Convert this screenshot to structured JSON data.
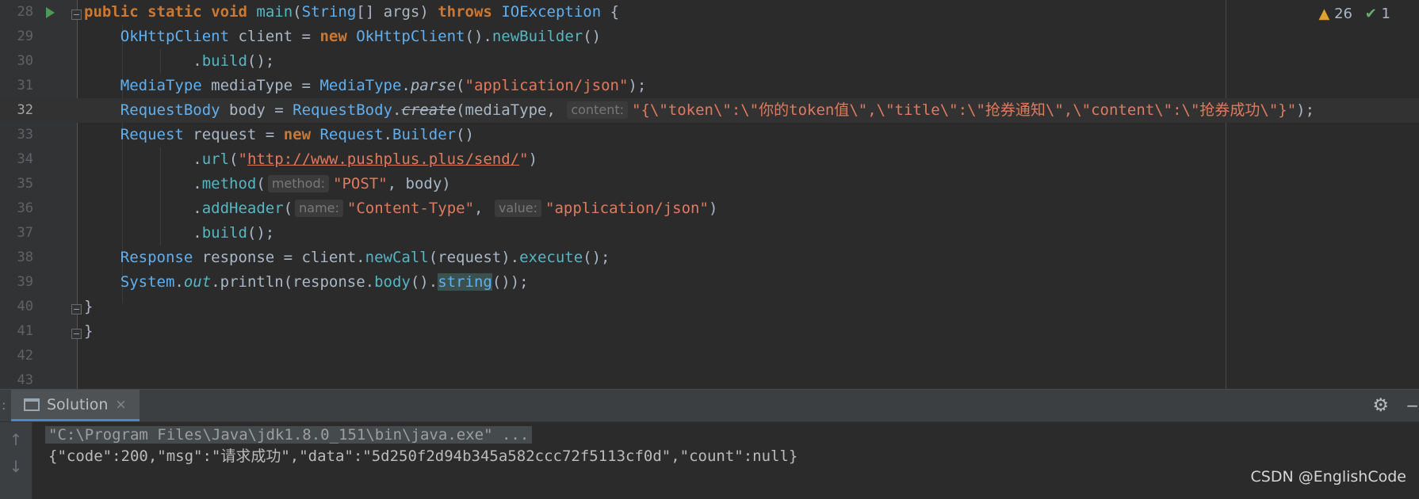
{
  "editor": {
    "inspections": {
      "warnings": "26",
      "ok": "1"
    },
    "lines": [
      {
        "n": "28",
        "parts": [
          {
            "t": "public",
            "c": "kw"
          },
          {
            "t": " "
          },
          {
            "t": "static",
            "c": "kw"
          },
          {
            "t": " "
          },
          {
            "t": "void",
            "c": "kw"
          },
          {
            "t": " "
          },
          {
            "t": "main",
            "c": "fn"
          },
          {
            "t": "("
          },
          {
            "t": "String",
            "c": "cls"
          },
          {
            "t": "[] args) "
          },
          {
            "t": "throws",
            "c": "kw"
          },
          {
            "t": " "
          },
          {
            "t": "IOException",
            "c": "cls"
          },
          {
            "t": " {"
          }
        ]
      },
      {
        "n": "29",
        "parts": [
          {
            "t": "    "
          },
          {
            "t": "OkHttpClient",
            "c": "cls"
          },
          {
            "t": " client = "
          },
          {
            "t": "new",
            "c": "kw"
          },
          {
            "t": " "
          },
          {
            "t": "OkHttpClient",
            "c": "cls"
          },
          {
            "t": "()."
          },
          {
            "t": "newBuilder",
            "c": "fn"
          },
          {
            "t": "()"
          }
        ]
      },
      {
        "n": "30",
        "parts": [
          {
            "t": "            ."
          },
          {
            "t": "build",
            "c": "fn"
          },
          {
            "t": "();"
          }
        ]
      },
      {
        "n": "31",
        "parts": [
          {
            "t": "    "
          },
          {
            "t": "MediaType",
            "c": "cls"
          },
          {
            "t": " mediaType = "
          },
          {
            "t": "MediaType",
            "c": "cls"
          },
          {
            "t": "."
          },
          {
            "t": "parse",
            "c": "it"
          },
          {
            "t": "("
          },
          {
            "t": "\"application/json\"",
            "c": "str"
          },
          {
            "t": ");"
          }
        ]
      },
      {
        "n": "32",
        "current": true,
        "parts": [
          {
            "t": "    "
          },
          {
            "t": "RequestBody",
            "c": "cls"
          },
          {
            "t": " body = "
          },
          {
            "t": "RequestBody",
            "c": "cls"
          },
          {
            "t": "."
          },
          {
            "t": "create",
            "c": "it del"
          },
          {
            "t": "(mediaType, "
          },
          {
            "t": "content:",
            "c": "hint"
          },
          {
            "t": "\"{\\\"token\\\":\\\"你的token值\\\",\\\"title\\\":\\\"抢券通知\\\",\\\"content\\\":\\\"抢券成功\\\"}\"",
            "c": "str"
          },
          {
            "t": ");"
          }
        ]
      },
      {
        "n": "33",
        "parts": [
          {
            "t": "    "
          },
          {
            "t": "Request",
            "c": "cls"
          },
          {
            "t": " request = "
          },
          {
            "t": "new",
            "c": "kw"
          },
          {
            "t": " "
          },
          {
            "t": "Request",
            "c": "cls"
          },
          {
            "t": "."
          },
          {
            "t": "Builder",
            "c": "cls"
          },
          {
            "t": "()"
          }
        ]
      },
      {
        "n": "34",
        "parts": [
          {
            "t": "            ."
          },
          {
            "t": "url",
            "c": "fn"
          },
          {
            "t": "("
          },
          {
            "t": "\"",
            "c": "str"
          },
          {
            "t": "http://www.pushplus.plus/send/",
            "c": "str url"
          },
          {
            "t": "\"",
            "c": "str"
          },
          {
            "t": ")"
          }
        ]
      },
      {
        "n": "35",
        "parts": [
          {
            "t": "            ."
          },
          {
            "t": "method",
            "c": "fn"
          },
          {
            "t": "("
          },
          {
            "t": "method:",
            "c": "hint"
          },
          {
            "t": "\"POST\"",
            "c": "str"
          },
          {
            "t": ", body)"
          }
        ]
      },
      {
        "n": "36",
        "parts": [
          {
            "t": "            ."
          },
          {
            "t": "addHeader",
            "c": "fn"
          },
          {
            "t": "("
          },
          {
            "t": "name:",
            "c": "hint"
          },
          {
            "t": "\"Content-Type\"",
            "c": "str"
          },
          {
            "t": ", "
          },
          {
            "t": "value:",
            "c": "hint"
          },
          {
            "t": "\"application/json\"",
            "c": "str"
          },
          {
            "t": ")"
          }
        ]
      },
      {
        "n": "37",
        "parts": [
          {
            "t": "            ."
          },
          {
            "t": "build",
            "c": "fn"
          },
          {
            "t": "();"
          }
        ]
      },
      {
        "n": "38",
        "parts": [
          {
            "t": "    "
          },
          {
            "t": "Response",
            "c": "cls"
          },
          {
            "t": " response = client."
          },
          {
            "t": "newCall",
            "c": "fn"
          },
          {
            "t": "(request)."
          },
          {
            "t": "execute",
            "c": "fn"
          },
          {
            "t": "();"
          }
        ]
      },
      {
        "n": "39",
        "parts": [
          {
            "t": "    "
          },
          {
            "t": "System",
            "c": "cls"
          },
          {
            "t": "."
          },
          {
            "t": "out",
            "c": "fn it"
          },
          {
            "t": ".println(response."
          },
          {
            "t": "body",
            "c": "fn"
          },
          {
            "t": "()."
          },
          {
            "t": "string",
            "c": "hl"
          },
          {
            "t": "());"
          }
        ]
      },
      {
        "n": "40",
        "parts": [
          {
            "t": "}"
          }
        ]
      },
      {
        "n": "41",
        "parts": [
          {
            "t": "}"
          }
        ]
      },
      {
        "n": "42",
        "parts": []
      },
      {
        "n": "43",
        "parts": []
      }
    ]
  },
  "run_panel": {
    "tab_label": "Solution",
    "tab_close": "×",
    "left_stub": ":",
    "gear": "⚙",
    "minimize": "−",
    "up_arrow": "↑",
    "down_arrow": "↓",
    "console": {
      "command": "\"C:\\Program Files\\Java\\jdk1.8.0_151\\bin\\java.exe\" ...",
      "output": "{\"code\":200,\"msg\":\"请求成功\",\"data\":\"5d250f2d94b345a582ccc72f5113cf0d\",\"count\":null}"
    }
  },
  "watermark": "CSDN @EnglishCode"
}
